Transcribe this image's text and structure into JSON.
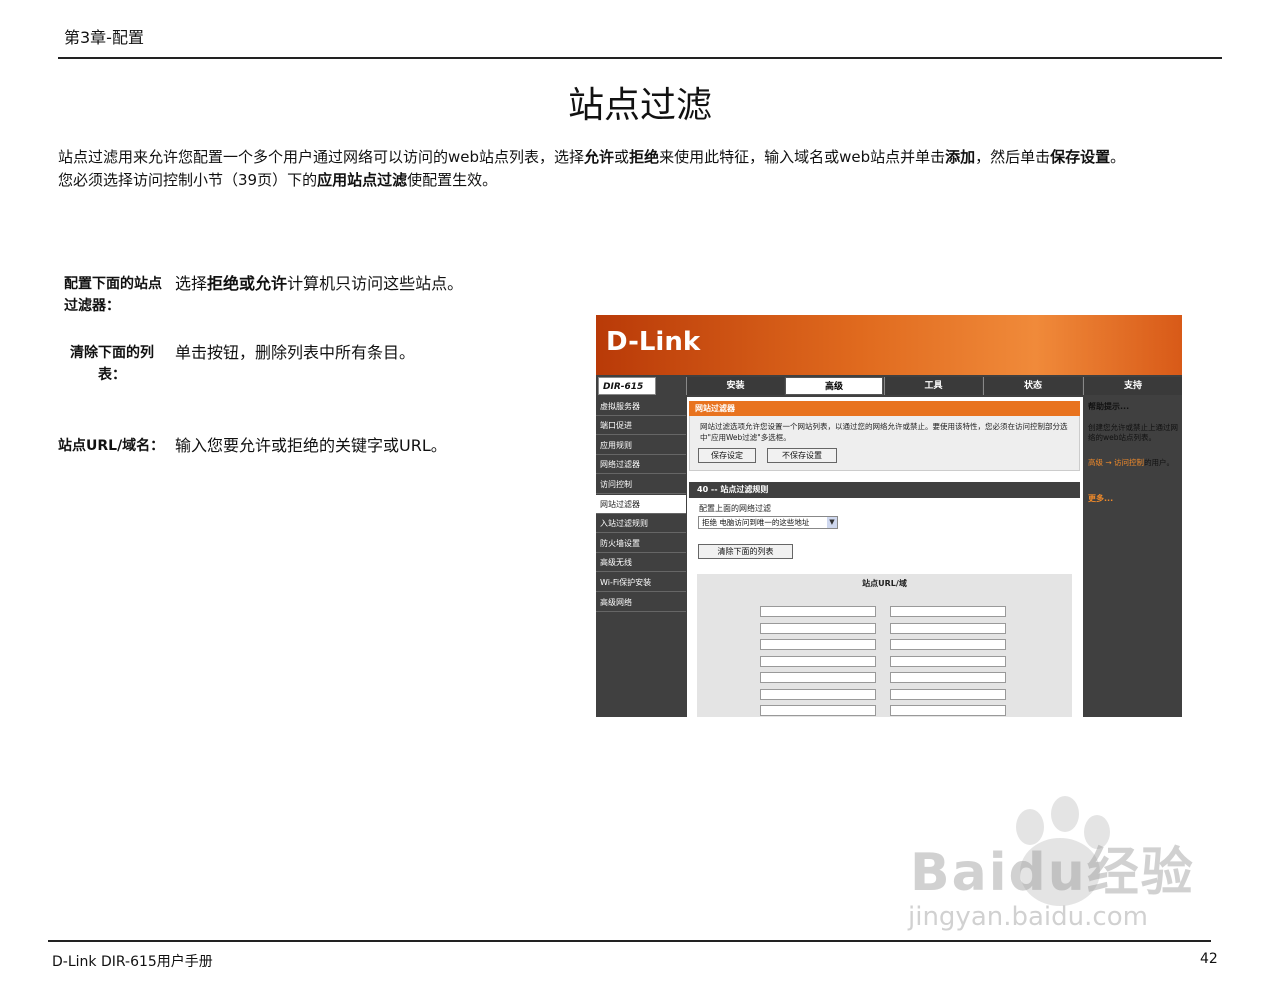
{
  "header": {
    "chapter": "第3章-配置"
  },
  "page_title": "站点过滤",
  "intro": {
    "p1": "站点过滤用来允许您配置一个多个用户通过网络可以访问的web站点列表，选择",
    "b1": "允许",
    "p2": "或",
    "b2": "拒绝",
    "p3": "来使用此特征，输入域名或web站点并单击",
    "b3": "添加",
    "p4": "，然后单击",
    "b4": "保存设置",
    "p5": "。",
    "line2_a": "您必须选择访问控制小节（39页）下的",
    "line2_b": "应用站点过滤",
    "line2_c": "使配置生效。"
  },
  "definitions": [
    {
      "term": "配置下面的站点过滤器：",
      "desc_bold1": "拒绝",
      "desc_mid": "或",
      "desc_bold2": "允许",
      "desc_rest": "计算机只访问这些站点。",
      "desc_prefix": "选择"
    },
    {
      "term": "清除下面的列表：",
      "desc": "单击按钮，删除列表中所有条目。"
    },
    {
      "term": "站点URL/域名：",
      "desc": "输入您要允许或拒绝的关键字或URL。"
    }
  ],
  "screenshot": {
    "brand": "D-Link",
    "model": "DIR-615",
    "tabs": [
      "安装",
      "高级",
      "工具",
      "状态",
      "支持"
    ],
    "active_tab": "高级",
    "nav": [
      "虚拟服务器",
      "端口促进",
      "应用规则",
      "网络过滤器",
      "访问控制",
      "网站过滤器",
      "入站过滤规则",
      "防火墙设置",
      "高级无线",
      "Wi-Fi保护安装",
      "高级网络"
    ],
    "active_nav": "网站过滤器",
    "section_title": "网站过滤器",
    "section_text": "网站过滤选项允许您设置一个网站列表，以通过您的网络允许或禁止。要使用该特性，您必须在访问控制部分选中\"应用Web过滤\"多选框。",
    "save_button": "保存设定",
    "dont_save_button": "不保存设置",
    "rules_title": "40 -- 站点过滤规则",
    "rules_label": "配置上面的网络过滤",
    "rules_select": "拒绝 电脑访问到唯一的这些地址",
    "clear_button": "清除下面的列表",
    "url_header": "站点URL/域",
    "help_title": "帮助提示...",
    "help_text": "创建您允许或禁止上通过网络的web站点列表。",
    "help_link_a": "高级 → 访问控制",
    "help_link_b": "的用户。",
    "help_more": "更多..."
  },
  "footer": {
    "manual": "D-Link DIR-615用户手册",
    "page": "42"
  },
  "watermark": {
    "brand": "Baidu经验",
    "url": "jingyan.baidu.com"
  }
}
